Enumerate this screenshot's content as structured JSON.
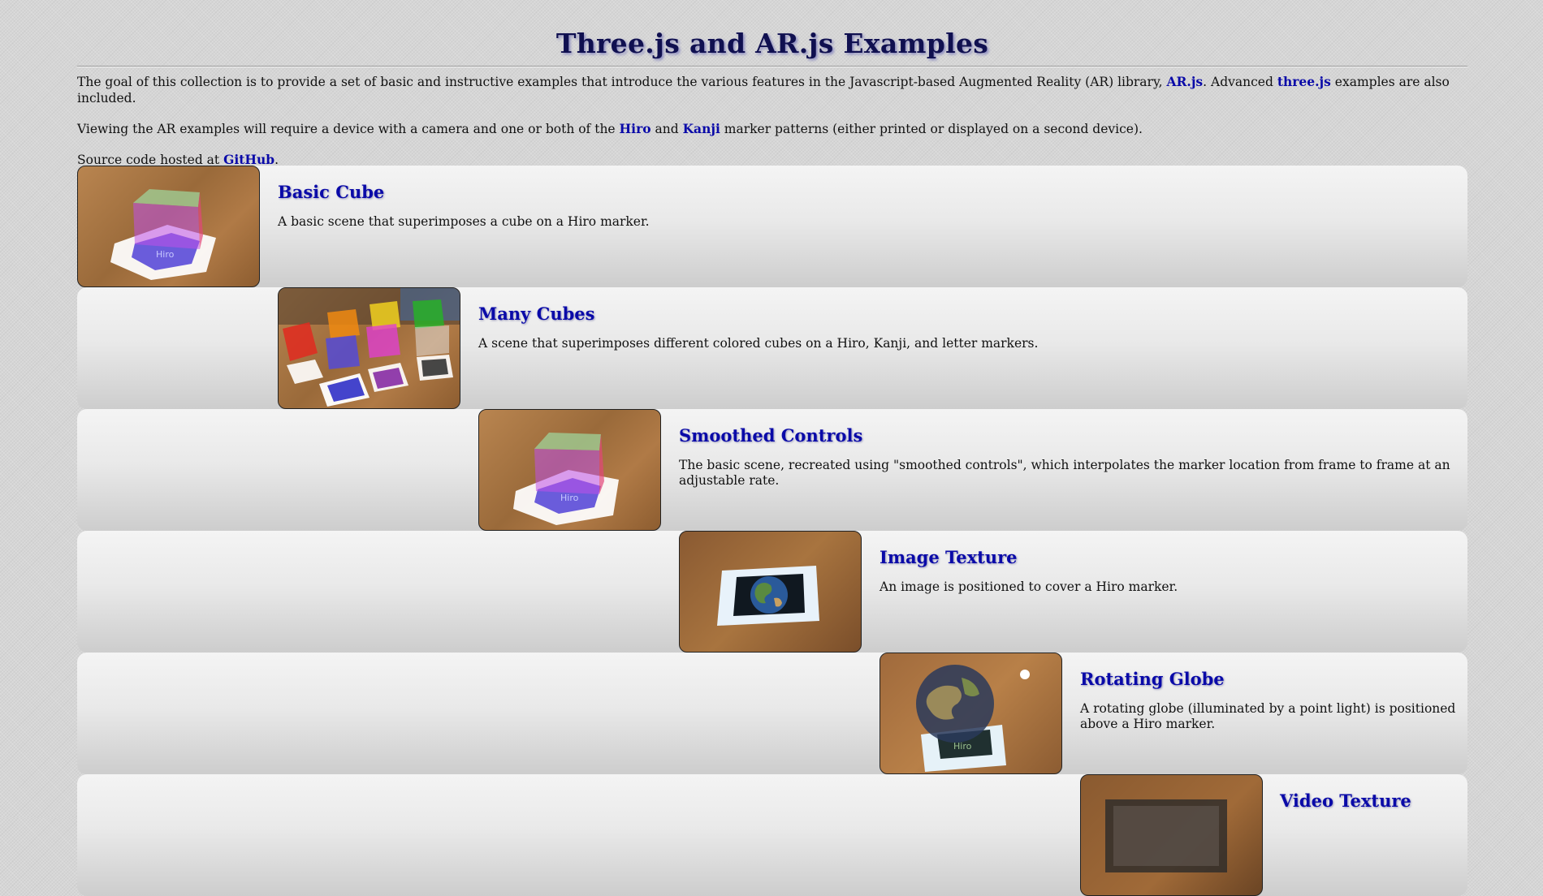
{
  "page": {
    "title": "Three.js and AR.js Examples",
    "intro1": {
      "before": "The goal of this collection is to provide a set of basic and instructive examples that introduce the various features in the Javascript-based Augmented Reality (AR) library, ",
      "link1": "AR.js",
      "middle": ". Advanced ",
      "link2": "three.js",
      "after": " examples are also included."
    },
    "intro2": {
      "before": "Viewing the AR examples will require a device with a camera and one or both of the ",
      "link1": "Hiro",
      "middle": " and ",
      "link2": "Kanji",
      "after": " marker patterns (either printed or displayed on a second device)."
    },
    "intro3": {
      "before": "Source code hosted at ",
      "link1": "GitHub",
      "after": "."
    }
  },
  "examples": [
    {
      "title": "Basic Cube",
      "description": "A basic scene that superimposes a cube on a Hiro marker.",
      "thumb_icon": "cube-on-marker"
    },
    {
      "title": "Many Cubes",
      "description": "A scene that superimposes different colored cubes on a Hiro, Kanji, and letter markers.",
      "thumb_icon": "many-cubes"
    },
    {
      "title": "Smoothed Controls",
      "description": "The basic scene, recreated using \"smoothed controls\", which interpolates the marker location from frame to frame at an adjustable rate.",
      "thumb_icon": "cube-on-marker"
    },
    {
      "title": "Image Texture",
      "description": "An image is positioned to cover a Hiro marker.",
      "thumb_icon": "earth-image"
    },
    {
      "title": "Rotating Globe",
      "description": "A rotating globe (illuminated by a point light) is positioned above a Hiro marker.",
      "thumb_icon": "globe"
    },
    {
      "title": "Video Texture",
      "description": "",
      "thumb_icon": "video"
    }
  ],
  "colors": {
    "link": "#0a0aa8",
    "title": "#101050",
    "wood": "#a8743f"
  }
}
